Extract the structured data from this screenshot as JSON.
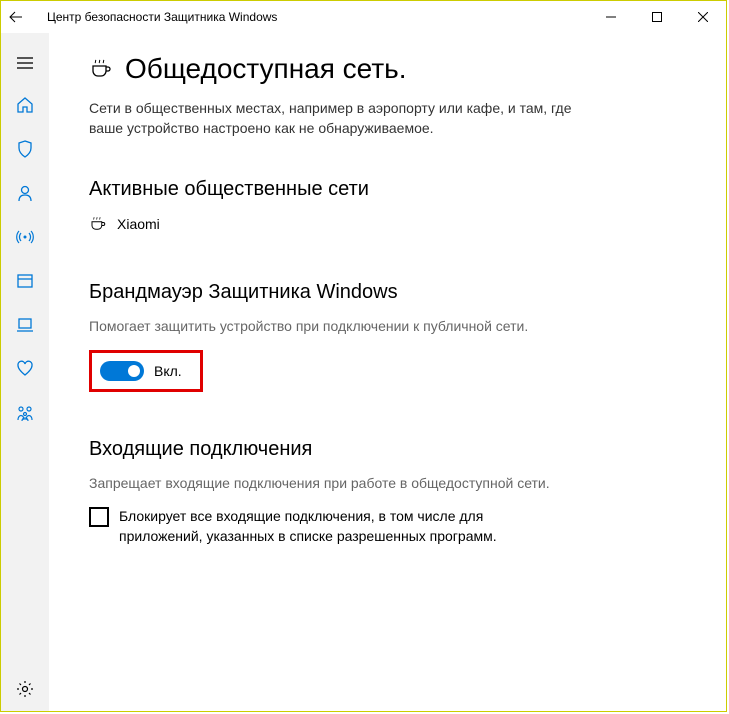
{
  "window": {
    "title": "Центр безопасности Защитника Windows"
  },
  "page": {
    "heading": "Общедоступная сеть.",
    "description": "Сети в общественных местах, например в аэропорту или кафе, и там, где ваше устройство настроено как не обнаруживаемое."
  },
  "active_networks": {
    "heading": "Активные общественные сети",
    "items": [
      {
        "name": "Xiaomi"
      }
    ]
  },
  "firewall": {
    "heading": "Брандмауэр Защитника Windows",
    "description": "Помогает защитить устройство при подключении к публичной сети.",
    "toggle_label": "Вкл.",
    "toggle_on": true
  },
  "incoming": {
    "heading": "Входящие подключения",
    "description": "Запрещает входящие подключения при работе в общедоступной сети.",
    "checkbox_label": "Блокирует все входящие подключения, в том числе для приложений, указанных в списке разрешенных программ.",
    "checked": false
  }
}
